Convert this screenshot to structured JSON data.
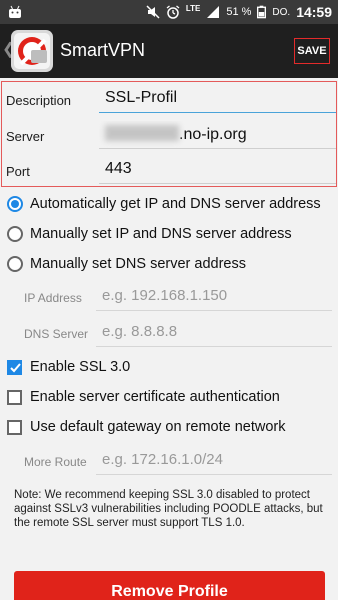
{
  "status_bar": {
    "battery_percent": "51 %",
    "day": "DO.",
    "time": "14:59",
    "network": "LTE",
    "icons": [
      "android-icon",
      "mute-icon",
      "alarm-icon",
      "signal-icon",
      "battery-icon"
    ]
  },
  "action_bar": {
    "title": "SmartVPN",
    "save_label": "SAVE",
    "logo_icon": "smartvpn-logo-icon"
  },
  "fields": {
    "description": {
      "label": "Description",
      "value": "SSL-Profil"
    },
    "server": {
      "label": "Server",
      "value_visible_suffix": ".no-ip.org"
    },
    "port": {
      "label": "Port",
      "value": "443"
    }
  },
  "address_options": {
    "items": [
      {
        "label": "Automatically get IP and DNS server address",
        "selected": true
      },
      {
        "label": "Manually set IP and DNS server address",
        "selected": false
      },
      {
        "label": "Manually set DNS server address",
        "selected": false
      }
    ]
  },
  "manual_fields": {
    "ip": {
      "label": "IP Address",
      "placeholder": "e.g. 192.168.1.150"
    },
    "dns": {
      "label": "DNS Server",
      "placeholder": "e.g. 8.8.8.8"
    }
  },
  "checkboxes": {
    "ssl3": {
      "label": "Enable SSL 3.0",
      "checked": true
    },
    "cert_auth": {
      "label": "Enable server certificate authentication",
      "checked": false
    },
    "default_gw": {
      "label": "Use default gateway on remote network",
      "checked": false
    }
  },
  "more_route": {
    "label": "More Route",
    "placeholder": "e.g. 172.16.1.0/24"
  },
  "note": "Note: We recommend keeping SSL 3.0 disabled to protect against SSLv3 vulnerabilities including POODLE attacks, but the remote SSL server must support TLS 1.0.",
  "remove_button": "Remove Profile",
  "colors": {
    "accent_blue": "#1e88e5",
    "highlight_red": "#e45a5a",
    "remove_red": "#e0231a",
    "actionbar_bg": "#1f1f1f"
  }
}
